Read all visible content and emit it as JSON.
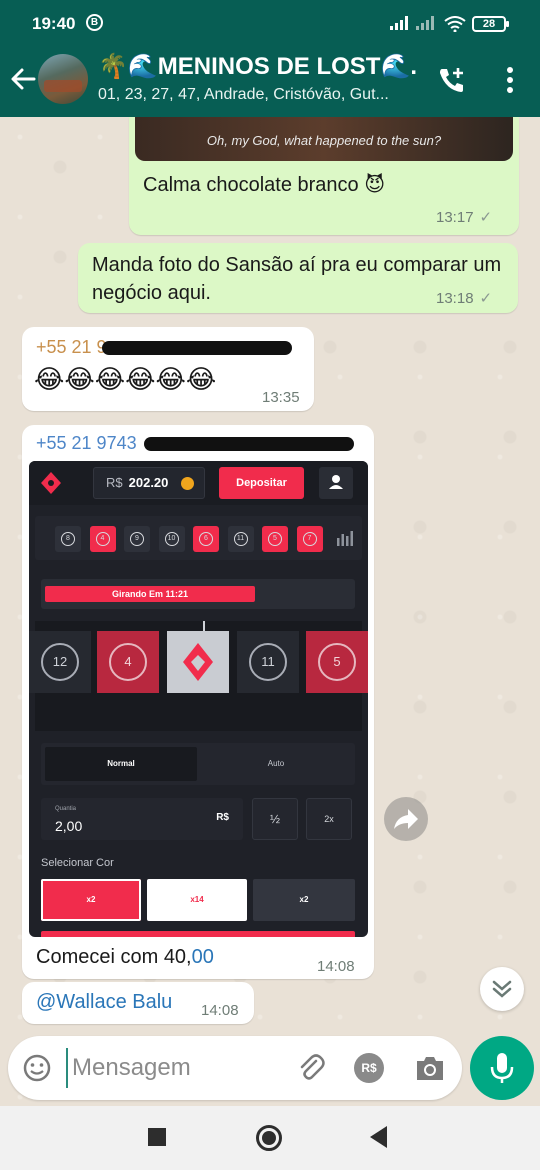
{
  "status_bar": {
    "time": "19:40",
    "b_badge": "B",
    "battery": "28"
  },
  "header": {
    "title": "🌴🌊MENINOS DE LOST🌊...",
    "subtitle": "01, 23, 27, 47, Andrade, Cristóvão, Gut..."
  },
  "messages": {
    "m1": {
      "video_caption": "Oh, my God, what happened to the sun?",
      "text": "Calma chocolate branco 😈",
      "time": "13:17"
    },
    "m2": {
      "text": "Manda foto do Sansão aí pra eu comparar um negócio aqui.",
      "time": "13:18"
    },
    "m3": {
      "sender": "+55 21 9",
      "text": "😂😂😂😂😂😂",
      "time": "13:35"
    },
    "m4": {
      "sender": "+55 21 9743",
      "caption_main": "Comecei com 40,",
      "caption_link": "00",
      "time": "14:08"
    },
    "m5": {
      "mention": "@Wallace Balu",
      "time": "14:08"
    }
  },
  "game": {
    "balance_currency": "R$",
    "balance": "202.20",
    "deposit_label": "Depositar",
    "history": [
      {
        "n": "8",
        "color": "dark"
      },
      {
        "n": "4",
        "color": "red"
      },
      {
        "n": "9",
        "color": "dark"
      },
      {
        "n": "10",
        "color": "dark"
      },
      {
        "n": "6",
        "color": "red"
      },
      {
        "n": "11",
        "color": "dark"
      },
      {
        "n": "5",
        "color": "red"
      },
      {
        "n": "7",
        "color": "red"
      }
    ],
    "countdown": "Girando Em 11:21",
    "roller": [
      {
        "n": "12",
        "color": "dark"
      },
      {
        "n": "4",
        "color": "red"
      },
      {
        "n": "",
        "color": "white"
      },
      {
        "n": "11",
        "color": "dark"
      },
      {
        "n": "5",
        "color": "red"
      }
    ],
    "mode_normal": "Normal",
    "mode_auto": "Auto",
    "amount_label": "Quantia",
    "amount_value": "2,00",
    "amount_currency": "R$",
    "half_label": "½",
    "double_label": "2x",
    "select_label": "Selecionar Cor",
    "colors": {
      "red": "x2",
      "white": "x14",
      "black": "x2"
    }
  },
  "input": {
    "placeholder": "Mensagem",
    "pay_label": "R$"
  },
  "colors": {
    "header": "#075e54",
    "outgoing": "#dcf8c6",
    "accent_green": "#00a884",
    "game_red": "#f12c4c"
  }
}
